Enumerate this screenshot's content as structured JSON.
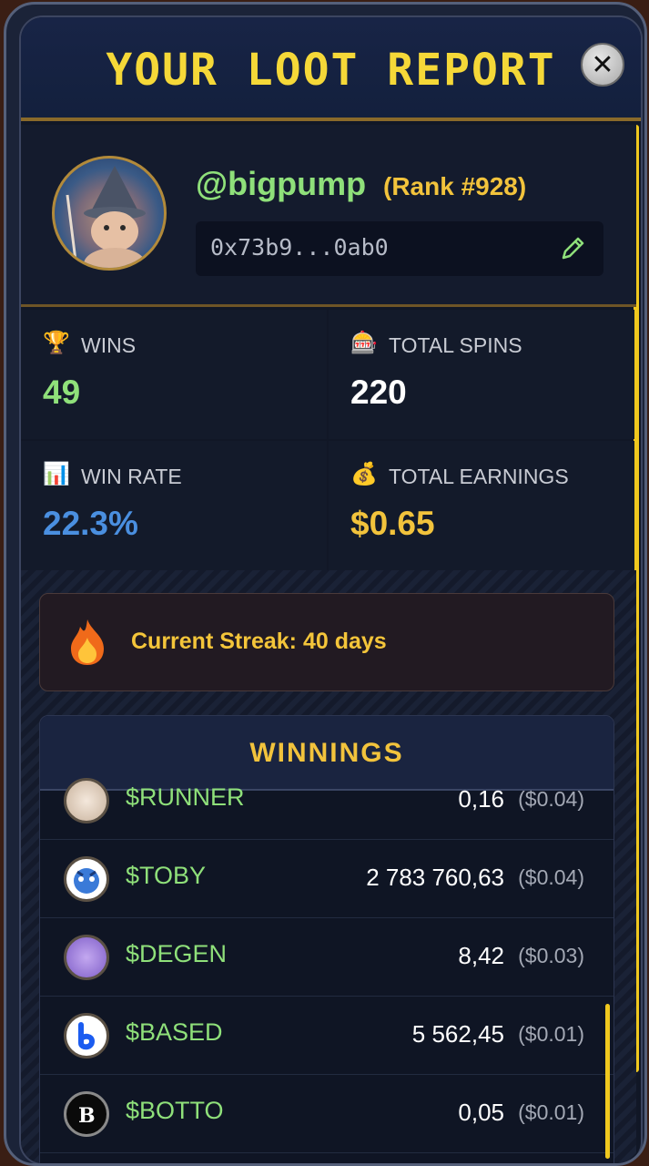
{
  "header": {
    "title": "YOUR LOOT REPORT",
    "close_symbol": "✕"
  },
  "profile": {
    "username": "@bigpump",
    "rank": "(Rank #928)",
    "wallet": "0x73b9...0ab0"
  },
  "stats": {
    "wins": {
      "label": "WINS",
      "value": "49",
      "icon": "trophy-icon",
      "color": "#8fe07a"
    },
    "total_spins": {
      "label": "TOTAL SPINS",
      "value": "220",
      "icon": "slot-machine-icon",
      "color": "#ffffff"
    },
    "win_rate": {
      "label": "WIN RATE",
      "value": "22.3%",
      "icon": "bar-chart-icon",
      "color": "#4a8fe0"
    },
    "total_earnings": {
      "label": "TOTAL EARNINGS",
      "value": "$0.65",
      "icon": "money-bag-icon",
      "color": "#f2c33c"
    }
  },
  "streak": {
    "text": "Current Streak: 40 days",
    "icon": "fire-icon"
  },
  "winnings": {
    "title": "WINNINGS",
    "rows": [
      {
        "token": "$RUNNER",
        "amount": "0,16",
        "usd": "($0.04)",
        "icon": "runner-token-icon"
      },
      {
        "token": "$TOBY",
        "amount": "2 783 760,63",
        "usd": "($0.04)",
        "icon": "toby-token-icon"
      },
      {
        "token": "$DEGEN",
        "amount": "8,42",
        "usd": "($0.03)",
        "icon": "degen-token-icon"
      },
      {
        "token": "$BASED",
        "amount": "5 562,45",
        "usd": "($0.01)",
        "icon": "based-token-icon"
      },
      {
        "token": "$BOTTO",
        "amount": "0,05",
        "usd": "($0.01)",
        "icon": "botto-token-icon"
      }
    ]
  },
  "colors": {
    "accent": "#f5d838",
    "green": "#8fe07a",
    "blue": "#4a8fe0"
  }
}
